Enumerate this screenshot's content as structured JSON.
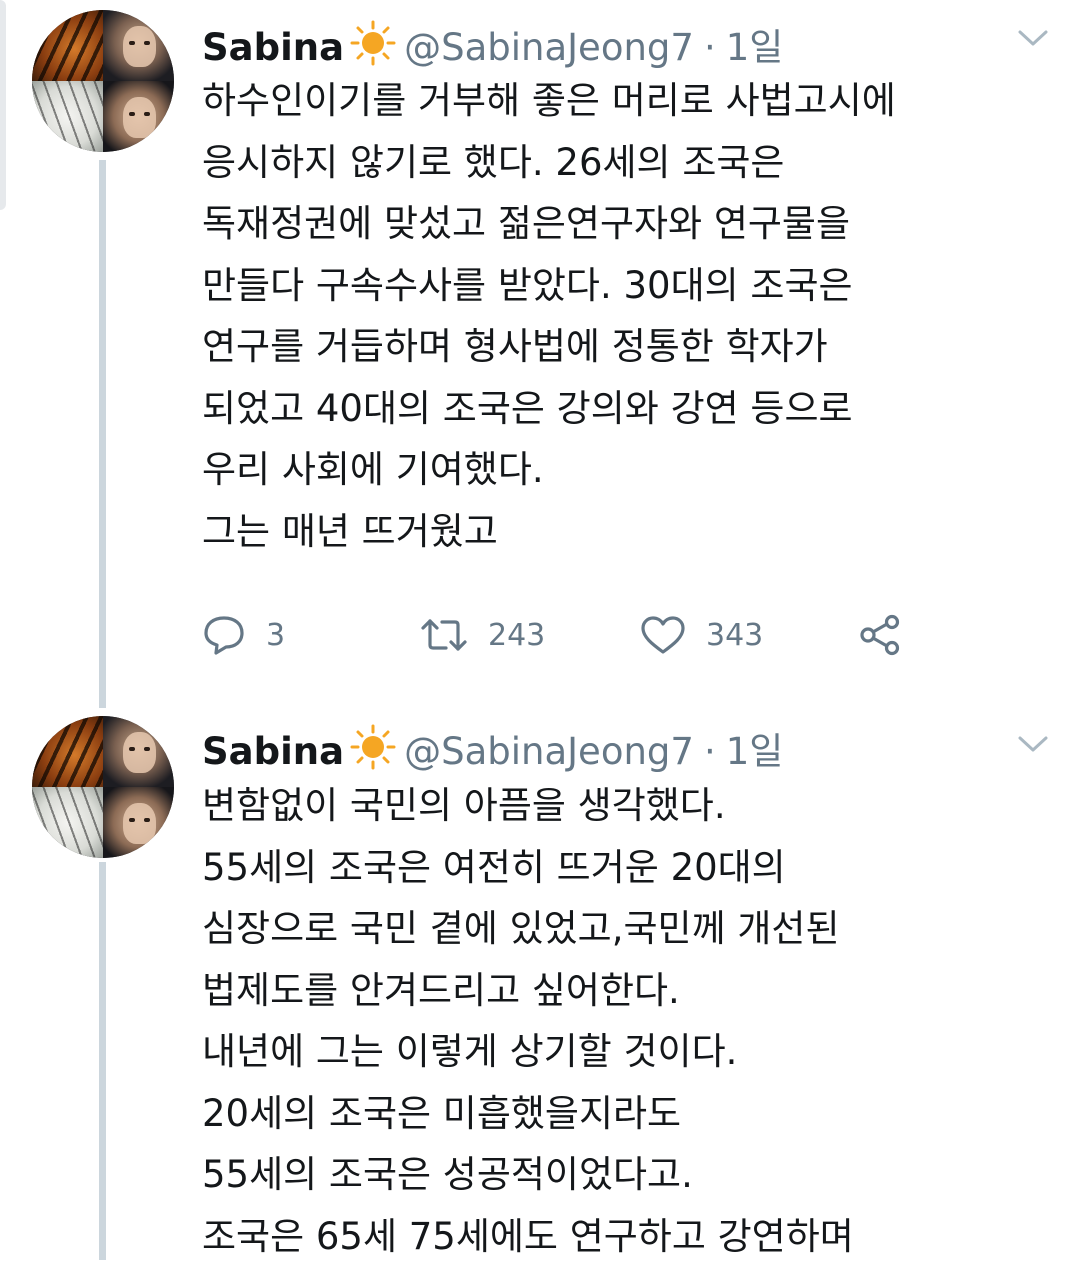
{
  "tweets": [
    {
      "name": "Sabina",
      "handle": "@SabinaJeong7",
      "separator": "·",
      "time": "1일",
      "lines": [
        "하수인이기를 거부해 좋은 머리로 사법고시에",
        "응시하지 않기로 했다. 26세의 조국은",
        "독재정권에 맞섰고 젊은연구자와 연구물을",
        "만들다 구속수사를 받았다. 30대의 조국은",
        "연구를 거듭하며 형사법에 정통한 학자가",
        "되었고 40대의 조국은 강의와 강연 등으로",
        "우리 사회에 기여했다.",
        "그는 매년 뜨거웠고"
      ],
      "actions": {
        "reply_count": "3",
        "retweet_count": "243",
        "like_count": "343"
      }
    },
    {
      "name": "Sabina",
      "handle": "@SabinaJeong7",
      "separator": "·",
      "time": "1일",
      "lines": [
        "변함없이 국민의 아픔을 생각했다.",
        "55세의 조국은 여전히 뜨거운 20대의",
        "심장으로 국민 곁에 있었고,국민께 개선된",
        "법제도를 안겨드리고 싶어한다.",
        "내년에 그는 이렇게 상기할 것이다.",
        "20세의 조국은 미흡했을지라도",
        "55세의 조국은 성공적이었다고.",
        "조국은 65세 75세에도 연구하고 강연하며"
      ]
    }
  ],
  "icons": {
    "name_emoji": "sun-emoji",
    "menu": "chevron-down-icon",
    "reply": "reply-icon",
    "retweet": "retweet-icon",
    "like": "heart-icon",
    "share": "share-icon"
  },
  "colors": {
    "text": "#14171a",
    "secondary": "#657786",
    "thread_line": "#ccd6dd",
    "sun": "#f5a623"
  }
}
